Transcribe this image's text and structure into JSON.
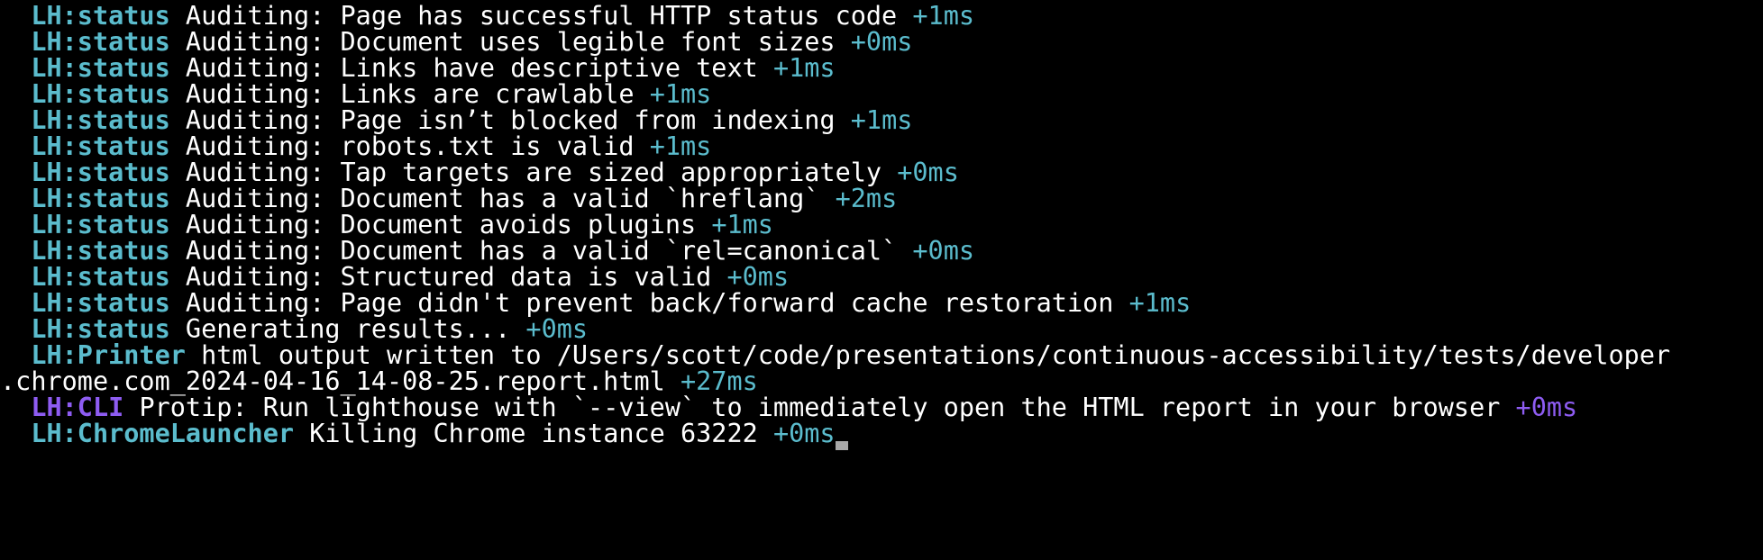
{
  "terminal": {
    "lines": [
      {
        "indent": "  ",
        "tag": "LH:status",
        "text": " Auditing: Page has successful HTTP status code ",
        "time": "+1ms"
      },
      {
        "indent": "  ",
        "tag": "LH:status",
        "text": " Auditing: Document uses legible font sizes ",
        "time": "+0ms"
      },
      {
        "indent": "  ",
        "tag": "LH:status",
        "text": " Auditing: Links have descriptive text ",
        "time": "+1ms"
      },
      {
        "indent": "  ",
        "tag": "LH:status",
        "text": " Auditing: Links are crawlable ",
        "time": "+1ms"
      },
      {
        "indent": "  ",
        "tag": "LH:status",
        "text": " Auditing: Page isn’t blocked from indexing ",
        "time": "+1ms"
      },
      {
        "indent": "  ",
        "tag": "LH:status",
        "text": " Auditing: robots.txt is valid ",
        "time": "+1ms"
      },
      {
        "indent": "  ",
        "tag": "LH:status",
        "text": " Auditing: Tap targets are sized appropriately ",
        "time": "+0ms"
      },
      {
        "indent": "  ",
        "tag": "LH:status",
        "text": " Auditing: Document has a valid `hreflang` ",
        "time": "+2ms"
      },
      {
        "indent": "  ",
        "tag": "LH:status",
        "text": " Auditing: Document avoids plugins ",
        "time": "+1ms"
      },
      {
        "indent": "  ",
        "tag": "LH:status",
        "text": " Auditing: Document has a valid `rel=canonical` ",
        "time": "+0ms"
      },
      {
        "indent": "  ",
        "tag": "LH:status",
        "text": " Auditing: Structured data is valid ",
        "time": "+0ms"
      },
      {
        "indent": "  ",
        "tag": "LH:status",
        "text": " Auditing: Page didn't prevent back/forward cache restoration ",
        "time": "+1ms"
      },
      {
        "indent": "  ",
        "tag": "LH:status",
        "text": " Generating results... ",
        "time": "+0ms"
      },
      {
        "indent": "  ",
        "tag": "LH:Printer",
        "text": " html output written to /Users/scott/code/presentations/continuous-accessibility/tests/developer",
        "time": ""
      },
      {
        "indent": "",
        "tag": "",
        "text": ".chrome.com_2024-04-16_14-08-25.report.html ",
        "time": "+27ms"
      },
      {
        "indent": "  ",
        "tag": "LH:CLI",
        "text": " Protip: Run lighthouse with `--view` to immediately open the HTML report in your browser ",
        "time": "+0ms"
      },
      {
        "indent": "  ",
        "tag": "LH:ChromeLauncher",
        "text": " Killing Chrome instance 63222 ",
        "time": "+0ms"
      }
    ]
  },
  "colors": {
    "background": "#000000",
    "text": "#ffffff",
    "cyan": "#5bbccd",
    "purple": "#8e5cf2",
    "cursor": "#a8a8a8"
  }
}
